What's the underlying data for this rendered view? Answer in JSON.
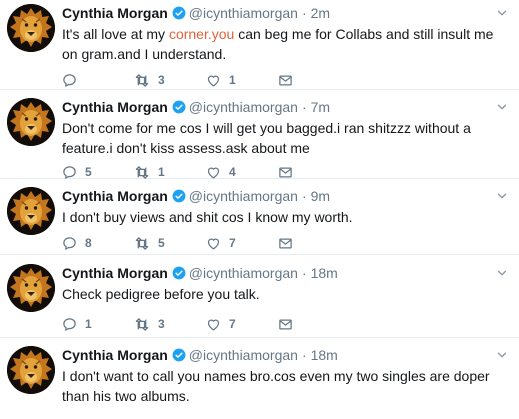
{
  "tweets": [
    {
      "name": "Cynthia Morgan",
      "handle": "@icynthiamorgan",
      "time": "2m",
      "text_before": "It's all love at my ",
      "link": "corner.you",
      "text_after": " can beg me for Collabs and still insult me on gram.and I understand.",
      "replies": "",
      "retweets": "3",
      "likes": "1"
    },
    {
      "name": "Cynthia Morgan",
      "handle": "@icynthiamorgan",
      "time": "7m",
      "text": "Don't come for me cos I will get you bagged.i ran shitzzz without a feature.i don't kiss assess.ask about me",
      "replies": "5",
      "retweets": "1",
      "likes": "4"
    },
    {
      "name": "Cynthia Morgan",
      "handle": "@icynthiamorgan",
      "time": "9m",
      "text": "I don't buy views and shit cos I know my worth.",
      "replies": "8",
      "retweets": "5",
      "likes": "7"
    },
    {
      "name": "Cynthia Morgan",
      "handle": "@icynthiamorgan",
      "time": "18m",
      "text": "Check pedigree before you talk.",
      "replies": "1",
      "retweets": "3",
      "likes": "7"
    },
    {
      "name": "Cynthia Morgan",
      "handle": "@icynthiamorgan",
      "time": "18m",
      "text": "I don't want to call you names bro.cos even my two singles are doper than his two albums."
    }
  ],
  "separator": "·",
  "colors": {
    "link": "#e0633d",
    "muted": "#657786",
    "verified": "#1da1f2",
    "divider": "#e6ecf0"
  },
  "icons": [
    "reply-icon",
    "retweet-icon",
    "like-icon",
    "message-icon",
    "verified-icon",
    "caret-down-icon"
  ]
}
